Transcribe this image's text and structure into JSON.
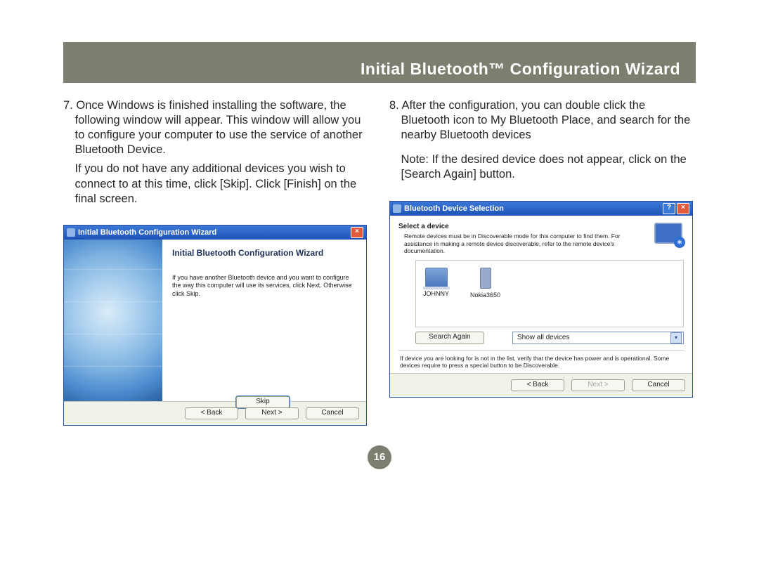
{
  "header": {
    "title": "Initial Bluetooth™ Configuration Wizard"
  },
  "left": {
    "num": "7.",
    "p1": "Once Windows is finished installing the software, the following window will appear.  This window will allow you to configure your computer to use the service of another Bluetooth Device.",
    "p2": "If you do not have any additional devices you wish to connect to at this time, click [Skip]. Click [Finish] on the final screen."
  },
  "right": {
    "num": "8.",
    "p1": "After the configuration, you can double click the Bluetooth icon to My Bluetooth Place, and search for the nearby Bluetooth devices",
    "p2": "Note: If the desired device does not appear, click on the [Search Again] button."
  },
  "win1": {
    "title": "Initial Bluetooth Configuration Wizard",
    "heading": "Initial Bluetooth Configuration Wizard",
    "body": "If you have another Bluetooth device and you want to configure the way this computer will use its services, click Next. Otherwise click Skip.",
    "skip": "Skip",
    "back": "< Back",
    "next": "Next >",
    "cancel": "Cancel"
  },
  "win2": {
    "title": "Bluetooth Device Selection",
    "select_label": "Select a device",
    "select_sub": "Remote devices must be in Discoverable mode for this computer to find them. For assistance in making a remote device discoverable, refer to the remote device's documentation.",
    "devices": [
      {
        "name": "JOHNNY"
      },
      {
        "name": "Nokia3650"
      }
    ],
    "search_again": "Search Again",
    "show_all": "Show all devices",
    "footer_note": "If device you are looking for is not in the list, verify that the device has power and is operational. Some devices require to press a special button to be Discoverable.",
    "back": "< Back",
    "next": "Next >",
    "cancel": "Cancel"
  },
  "page_number": "16"
}
